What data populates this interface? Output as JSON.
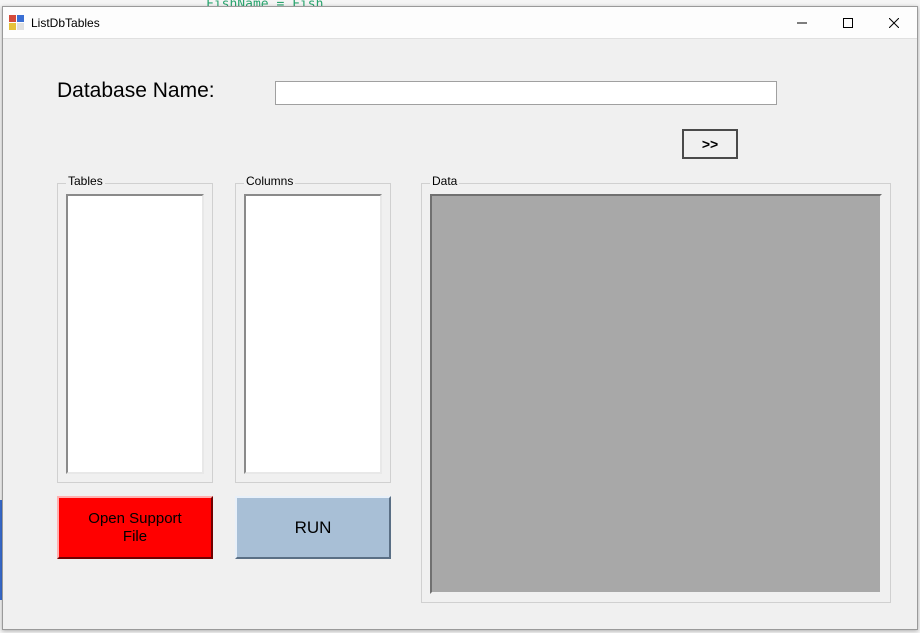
{
  "window": {
    "title": "ListDbTables"
  },
  "labels": {
    "database_name": "Database Name:",
    "tables_group": "Tables",
    "columns_group": "Columns",
    "data_group": "Data"
  },
  "inputs": {
    "database_name_value": "",
    "database_name_placeholder": ""
  },
  "buttons": {
    "expand": ">>",
    "open_support_line1": "Open Support",
    "open_support_line2": "File",
    "run": "RUN"
  },
  "colors": {
    "open_support_bg": "#ff0000",
    "run_bg": "#a8bfd6",
    "data_panel_bg": "#a8a8a8"
  },
  "bg_hint": "FishName = Fish"
}
